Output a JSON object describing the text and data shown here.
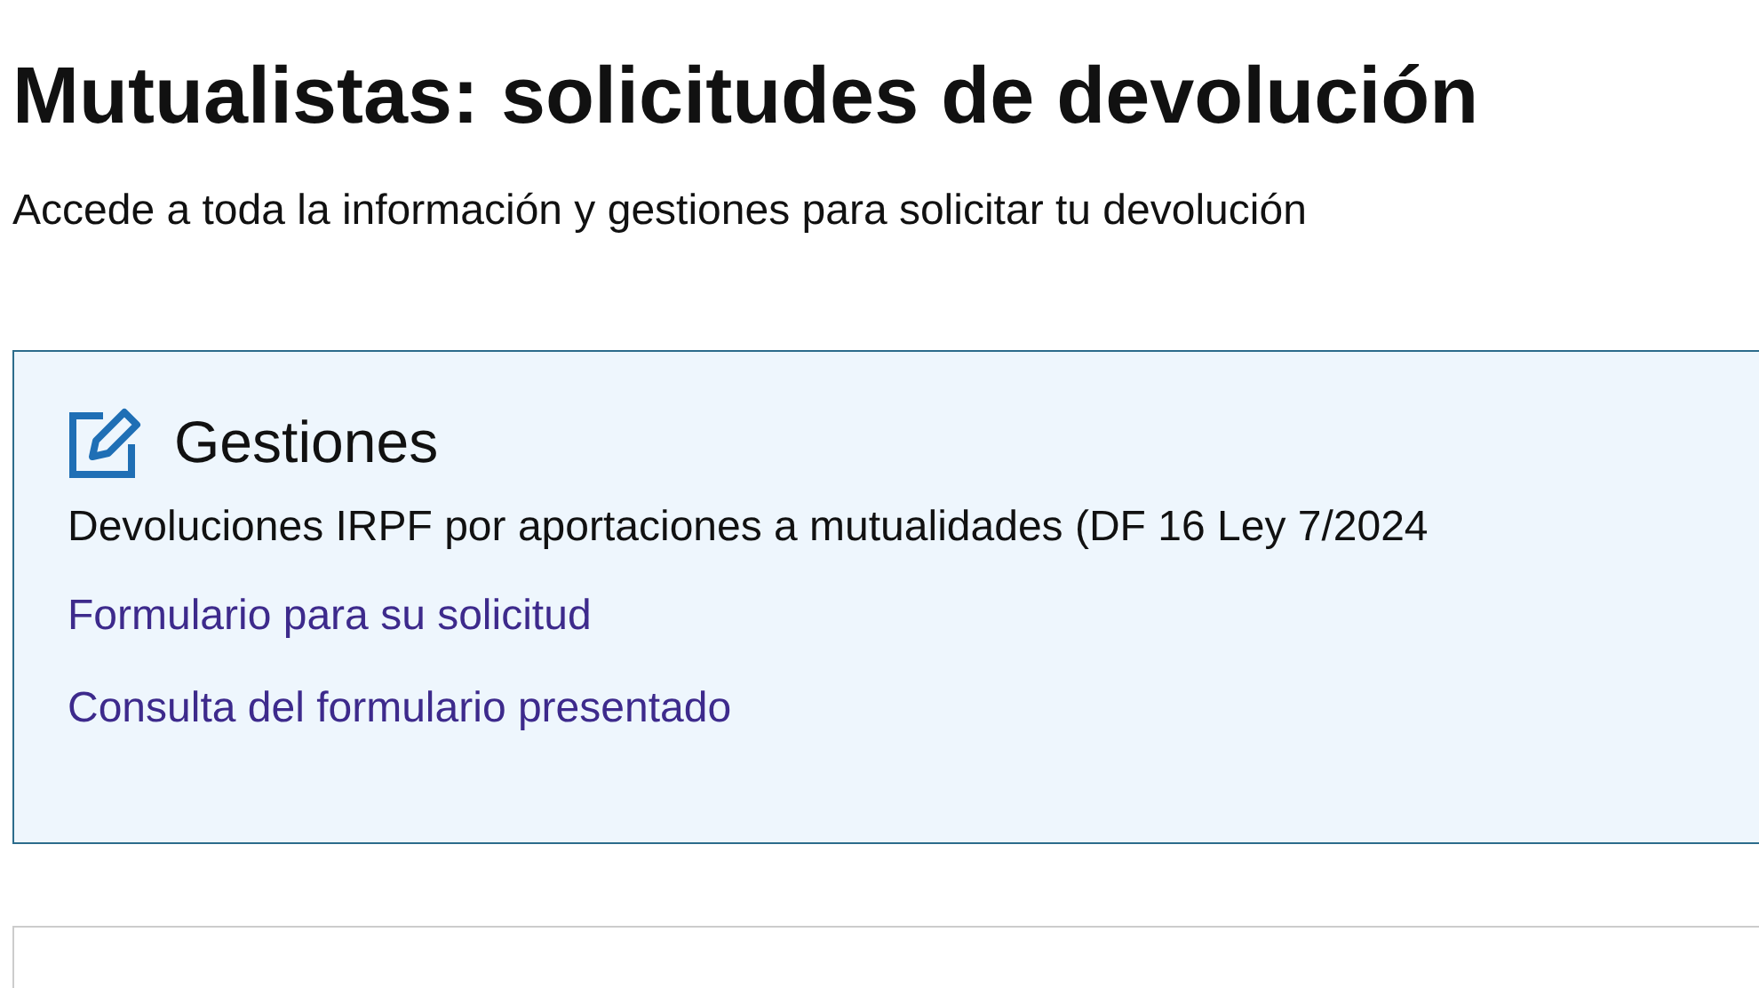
{
  "title": "Mutualistas: solicitudes de devolución",
  "subtitle": "Accede a toda la información y gestiones para solicitar tu devolución",
  "card": {
    "heading": "Gestiones",
    "description": "Devoluciones IRPF por aportaciones a mutualidades (DF 16 Ley 7/2024",
    "links": [
      "Formulario para su solicitud",
      "Consulta del formulario presentado"
    ]
  }
}
